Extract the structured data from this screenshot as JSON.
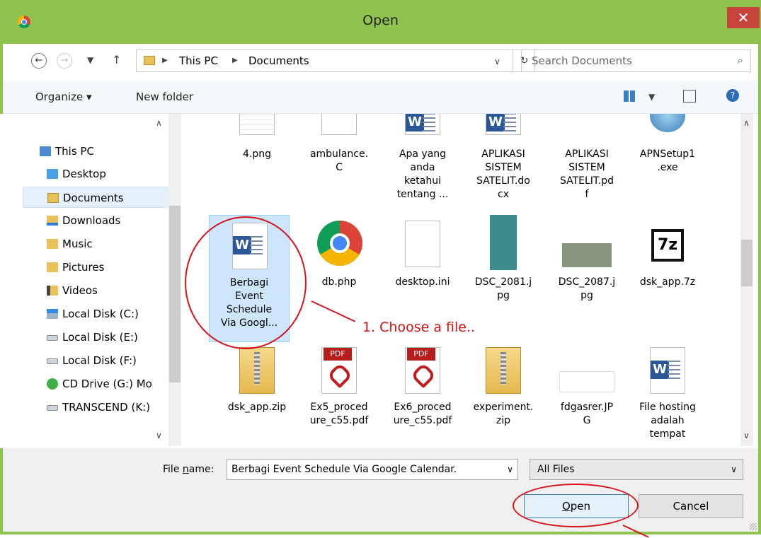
{
  "window": {
    "title": "Open",
    "close_glyph": "✕"
  },
  "address": {
    "crumbs": [
      "This PC",
      "Documents"
    ],
    "search_placeholder": "Search Documents"
  },
  "toolbar": {
    "organize": "Organize ▾",
    "new_folder": "New folder"
  },
  "nav": {
    "items": [
      {
        "label": "This PC",
        "icon": "computer-icon"
      },
      {
        "label": "Desktop",
        "icon": "desktop-folder-icon"
      },
      {
        "label": "Documents",
        "icon": "documents-folder-icon"
      },
      {
        "label": "Downloads",
        "icon": "downloads-folder-icon"
      },
      {
        "label": "Music",
        "icon": "music-folder-icon"
      },
      {
        "label": "Pictures",
        "icon": "pictures-folder-icon"
      },
      {
        "label": "Videos",
        "icon": "videos-folder-icon"
      },
      {
        "label": "Local Disk (C:)",
        "icon": "windows-drive-icon"
      },
      {
        "label": "Local Disk (E:)",
        "icon": "drive-icon"
      },
      {
        "label": "Local Disk (F:)",
        "icon": "drive-icon"
      },
      {
        "label": "CD Drive (G:) Mo",
        "icon": "cd-drive-icon"
      },
      {
        "label": "TRANSCEND (K:)",
        "icon": "drive-icon"
      }
    ]
  },
  "files": {
    "row1": [
      "4.png",
      "ambulance.\nC",
      "Apa yang\nanda\nketahui\ntentang ...",
      "APLIKASI\nSISTEM\nSATELIT.do\ncx",
      "APLIKASI\nSISTEM\nSATELIT.pd\nf",
      "APNSetup1\n.exe"
    ],
    "row2": [
      "Berbagi\nEvent\nSchedule\nVia Googl...",
      "db.php",
      "desktop.ini",
      "DSC_2081.j\npg",
      "DSC_2087.j\npg",
      "dsk_app.7z"
    ],
    "row3": [
      "dsk_app.zip",
      "Ex5_proced\nure_c55.pdf",
      "Ex6_proced\nure_c55.pdf",
      "experiment.\nzip",
      "fdgasrer.JP\nG",
      "File hosting\nadalah\ntempat"
    ]
  },
  "bottom": {
    "filename_label_pre": "File ",
    "filename_label_u": "n",
    "filename_label_post": "ame:",
    "filename_value": "Berbagi Event Schedule Via Google Calendar.",
    "filetype": "All Files",
    "open_u": "O",
    "open_rest": "pen",
    "cancel": "Cancel"
  },
  "annotation": {
    "text": "1. Choose a file..",
    "color": "#cc1414"
  },
  "colors": {
    "frame": "#8fc34d",
    "close": "#c7443c",
    "selection": "#cde6fb",
    "annotation": "#d6141c"
  }
}
